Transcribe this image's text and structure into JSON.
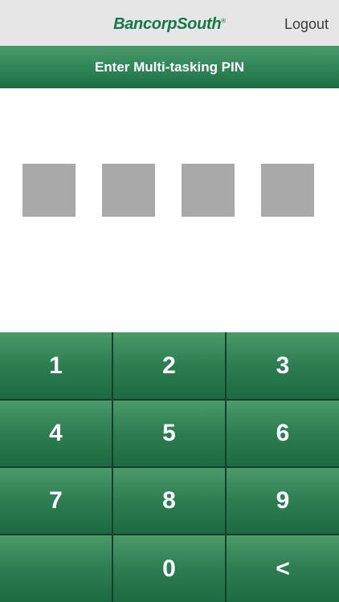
{
  "topbar": {
    "brand": "BancorpSouth",
    "brand_mark": "®",
    "logout_label": "Logout"
  },
  "header": {
    "title": "Enter Multi-tasking PIN"
  },
  "pin": {
    "length": 4,
    "filled": 0
  },
  "keypad": {
    "keys": [
      "1",
      "2",
      "3",
      "4",
      "5",
      "6",
      "7",
      "8",
      "9",
      "",
      "0",
      "<"
    ]
  },
  "colors": {
    "brand_green": "#16774a",
    "header_green": "#2f8458",
    "key_green": "#2e7d52",
    "pin_box_gray": "#a9a9a9",
    "topbar_gray": "#e6e6e6"
  }
}
